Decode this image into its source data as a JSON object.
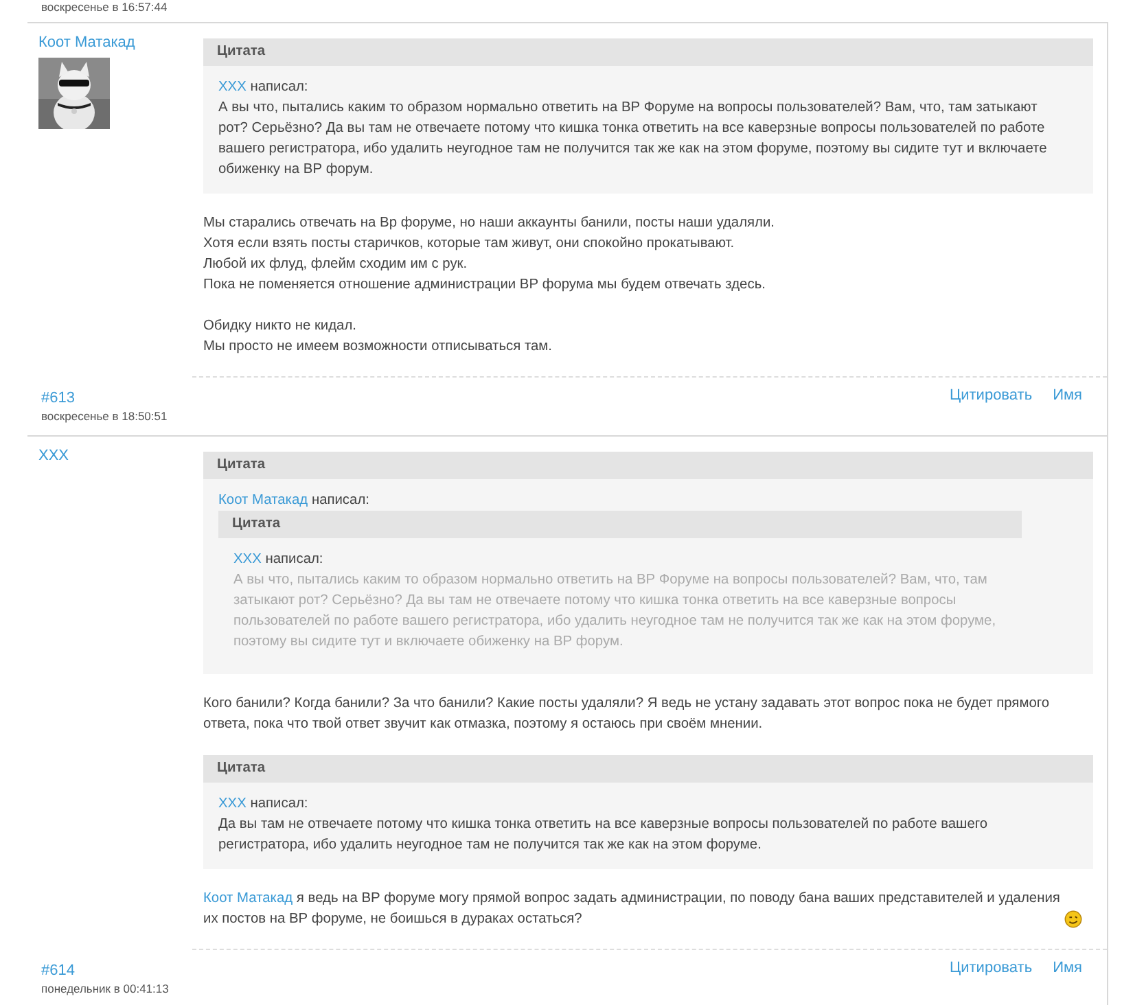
{
  "top_date": "воскресенье в 16:57:44",
  "posts": [
    {
      "author": "Коот Матакад",
      "avatar": {
        "kind": "picture"
      },
      "body": [
        {
          "kind": "quote",
          "title": "Цитата",
          "author": "XXX",
          "verb": "написал:",
          "collapsed": false,
          "body": [
            {
              "kind": "paragraph",
              "text": "А вы что, пытались каким то образом нормально ответить на ВР Форуме на вопросы пользователей? Вам, что, там затыкают\nрот? Серьёзно? Да вы там не отвечаете потому что кишка тонка ответить на все каверзные вопросы пользователей по работе\nвашего регистратора, ибо удалить неугодное там не получится так же как на этом форуме, поэтому вы сидите тут и включаете\nобиженку на ВР форум."
            }
          ]
        },
        {
          "kind": "paragraph",
          "text": "Мы старались отвечать на Вр форуме, но наши аккаунты банили, посты наши удаляли.\nХотя если взять посты старичков, которые там живут, они спокойно прокатывают.\nЛюбой их флуд, флейм сходим им с рук.\nПока не поменяется отношение администрации ВР форума мы будем отвечать здесь."
        },
        {
          "kind": "paragraph",
          "text": "Обидку никто не кидал.\nМы просто не имеем возможности отписываться там."
        }
      ],
      "number": "#613",
      "date": "воскресенье в 18:50:51",
      "actions": [
        "Цитировать",
        "Имя"
      ]
    },
    {
      "author": "XXX",
      "body": [
        {
          "kind": "quote",
          "title": "Цитата",
          "author": "Коот Матакад",
          "verb": "написал:",
          "collapsed": false,
          "body": [
            {
              "kind": "quote",
              "title": "Цитата",
              "author": "XXX",
              "verb": "написал:",
              "collapsed": true,
              "body": [
                {
                  "kind": "paragraph",
                  "text": "А вы что, пытались каким то образом нормально ответить на ВР Форуме на вопросы пользователей? Вам, что, там\nзатыкают рот? Серьёзно? Да вы там не отвечаете потому что кишка тонка ответить на все каверзные вопросы\nпользователей по работе вашего регистратора, ибо удалить неугодное там не получится так же как на этом форуме,\nпоэтому вы сидите тут и включаете обиженку на ВР форум."
                }
              ]
            }
          ]
        },
        {
          "kind": "paragraph",
          "text": "Кого банили? Когда банили? За что банили? Какие посты удаляли? Я ведь не устану задавать этот вопрос пока не будет прямого\nответа, пока что твой ответ звучит как отмазка, поэтому я остаюсь при своём мнении."
        },
        {
          "kind": "quote",
          "title": "Цитата",
          "author": "XXX",
          "verb": "написал:",
          "collapsed": false,
          "body": [
            {
              "kind": "paragraph",
              "text": "Да вы там не отвечаете потому что кишка тонка ответить на все каверзные вопросы пользователей по работе вашего\nрегистратора, ибо удалить неугодное там не получится так же как на этом форуме."
            }
          ]
        },
        {
          "kind": "mention",
          "name": "Коот Матакад",
          "text": " я ведь на ВР форуме могу прямой вопрос задать администрации, по поводу бана ваших представителей и удаления\nих постов на ВР форуме, не боишься в дураках остаться?",
          "smiley": true
        }
      ],
      "number": "#614",
      "date": "понедельник в 00:41:13",
      "actions": [
        "Цитировать",
        "Имя"
      ]
    }
  ]
}
